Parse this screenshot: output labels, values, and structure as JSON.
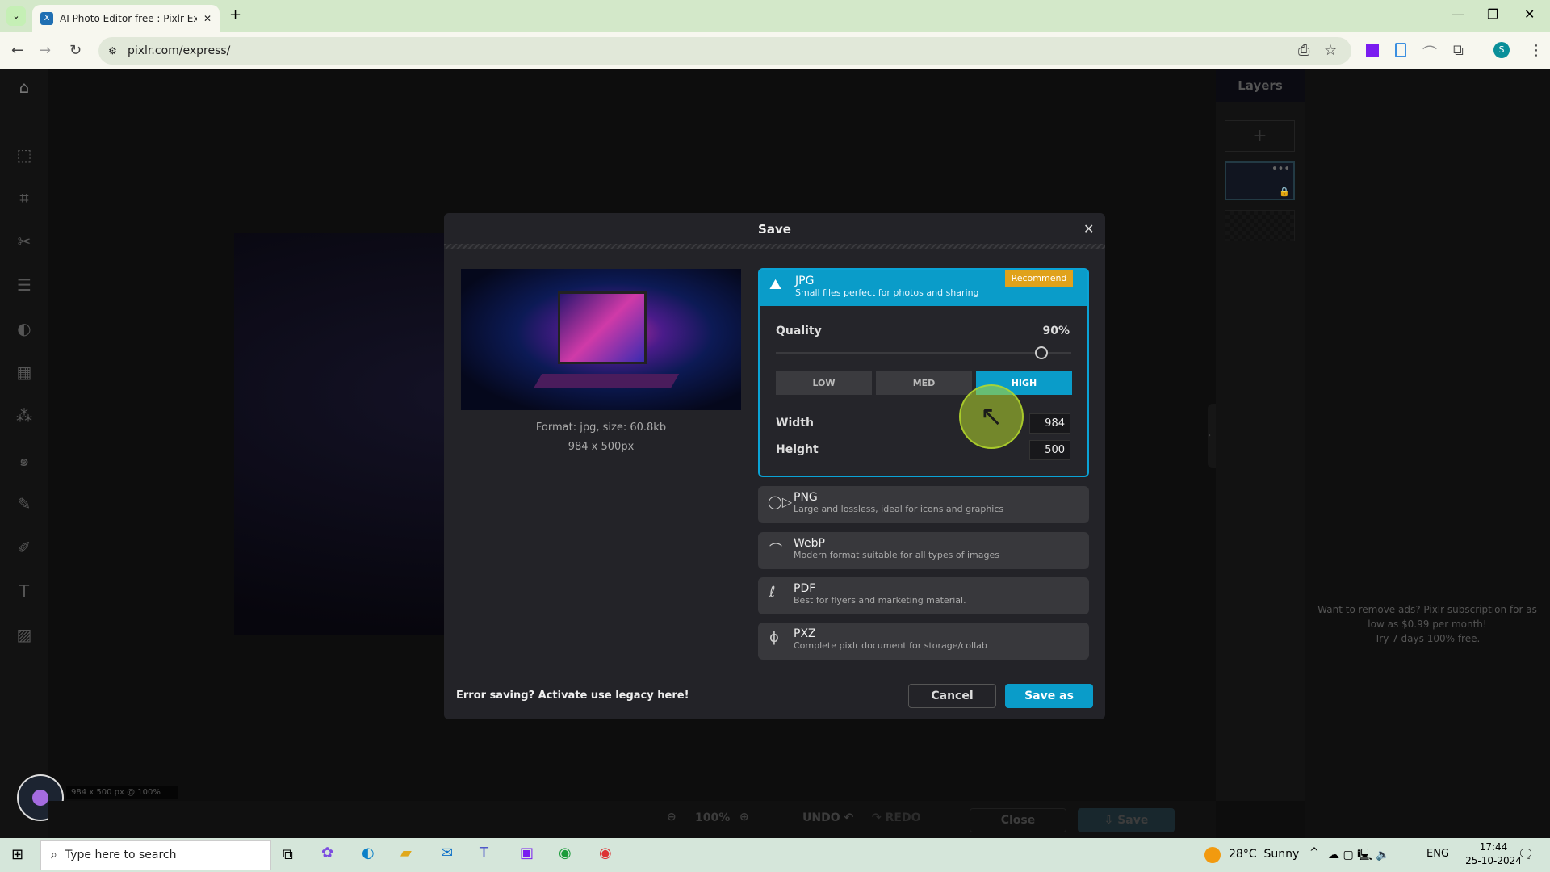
{
  "browser": {
    "tab_title": "AI Photo Editor free : Pixlr Expre",
    "url": "pixlr.com/express/",
    "profile": "S"
  },
  "editor": {
    "layers_title": "Layers",
    "status": "984 x 500 px @ 100%",
    "zoom": "100%",
    "undo": "UNDO",
    "redo": "REDO",
    "close": "Close",
    "save": "Save",
    "ad": [
      "Want to remove ads? Pixlr subscription for as",
      "low as $0.99 per month!",
      "Try 7 days 100% free."
    ]
  },
  "dialog": {
    "title": "Save",
    "format_info": "Format: jpg, size: 60.8kb",
    "dimensions": "984 x 500px",
    "jpg": {
      "title": "JPG",
      "desc": "Small files perfect for photos and sharing",
      "badge": "Recommend",
      "quality_label": "Quality",
      "quality": "90%",
      "quality_value": 90,
      "presets": [
        "LOW",
        "MED",
        "HIGH"
      ],
      "selected_preset": "HIGH",
      "width_label": "Width",
      "width": "984",
      "height_label": "Height",
      "height": "500"
    },
    "formats": [
      {
        "title": "PNG",
        "desc": "Large and lossless, ideal for icons and graphics"
      },
      {
        "title": "WebP",
        "desc": "Modern format suitable for all types of images"
      },
      {
        "title": "PDF",
        "desc": "Best for flyers and marketing material."
      },
      {
        "title": "PXZ",
        "desc": "Complete pixlr document for storage/collab"
      }
    ],
    "error_text": "Error saving? Activate use legacy here!",
    "cancel": "Cancel",
    "save_as": "Save as"
  },
  "taskbar": {
    "search": "Type here to search",
    "weather": "28°C  Sunny",
    "lang": "ENG",
    "time": "17:44",
    "date": "25-10-2024"
  },
  "colors": {
    "accent": "#0a9cc9",
    "badge": "#e0a21b",
    "cursor_highlight": "#b5d92c"
  }
}
